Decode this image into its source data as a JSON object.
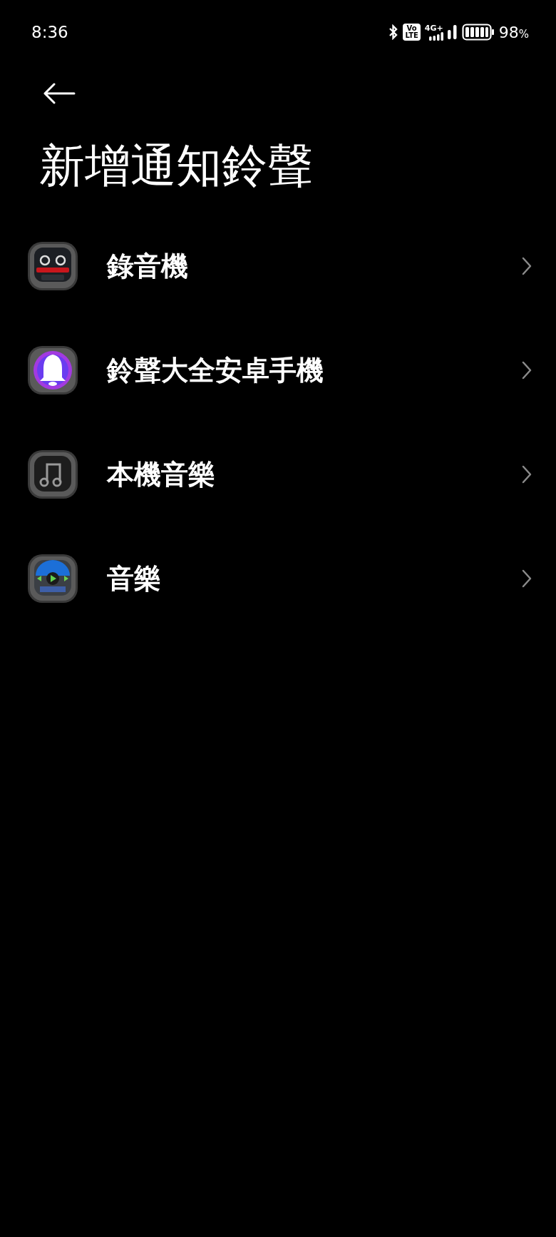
{
  "status_bar": {
    "time": "8:36",
    "volte_top": "Vo",
    "volte_bottom": "LTE",
    "network": "4G+",
    "battery": "98",
    "battery_unit": "%"
  },
  "title": "新增通知鈴聲",
  "items": [
    {
      "label": "錄音機",
      "kind": "recorder"
    },
    {
      "label": "鈴聲大全安卓手機",
      "kind": "bell"
    },
    {
      "label": "本機音樂",
      "kind": "note"
    },
    {
      "label": "音樂",
      "kind": "player"
    }
  ]
}
